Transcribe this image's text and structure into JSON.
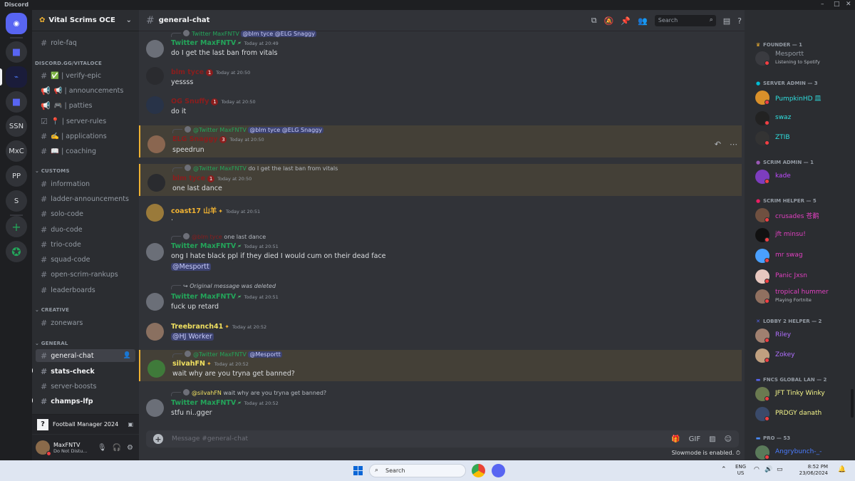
{
  "window": {
    "app_name": "Discord"
  },
  "rail": {
    "servers": [
      {
        "label": "SSN"
      },
      {
        "label": "MxC"
      },
      {
        "label": "PP"
      },
      {
        "label": "S"
      }
    ]
  },
  "server": {
    "name": "Vital Scrims OCE"
  },
  "channels": {
    "top": [
      {
        "name": "role-faq"
      }
    ],
    "cat_vital": "DISCORD.GG/VITALOCE",
    "vital": [
      {
        "name": "✅ | verify-epic"
      },
      {
        "name": "📢 | announcements"
      },
      {
        "name": "🎮 | patties"
      },
      {
        "name": "📍 | server-rules"
      },
      {
        "name": "✍️ | applications"
      },
      {
        "name": "📖 | coaching"
      }
    ],
    "cat_customs": "CUSTOMS",
    "customs": [
      {
        "name": "information"
      },
      {
        "name": "ladder-announcements"
      },
      {
        "name": "solo-code"
      },
      {
        "name": "duo-code"
      },
      {
        "name": "trio-code"
      },
      {
        "name": "squad-code"
      },
      {
        "name": "open-scrim-rankups"
      },
      {
        "name": "leaderboards"
      }
    ],
    "cat_creative": "CREATIVE",
    "creative": [
      {
        "name": "zonewars"
      }
    ],
    "cat_general": "GENERAL",
    "general": [
      {
        "name": "general-chat"
      },
      {
        "name": "stats-check"
      },
      {
        "name": "server-boosts"
      },
      {
        "name": "champs-lfp"
      }
    ]
  },
  "activity": {
    "game": "Football Manager 2024"
  },
  "user": {
    "name": "MaxFNTV",
    "status": "Do Not Distu..."
  },
  "chat": {
    "channel": "general-chat",
    "search_placeholder": "Search",
    "composer_placeholder": "Message #general-chat",
    "slowmode": "Slowmode is enabled."
  },
  "messages": [
    {
      "reply_user": "Twitter MaxFNTV",
      "reply_text": "@blm tyce  @ELG Snaggy",
      "user": "Twitter MaxFNTV",
      "time": "Today at 20:49",
      "text": "do I get the last ban from vitals"
    },
    {
      "user": "blm tyce",
      "time": "Today at 20:50",
      "text": "yessss"
    },
    {
      "user": "OG Snuffy",
      "time": "Today at 20:50",
      "text": "do it"
    },
    {
      "reply_user": "@Twitter MaxFNTV",
      "reply_text": "@blm tyce  @ELG Snaggy",
      "user": "ELG Snaggy",
      "time": "Today at 20:50",
      "text": "speedrun"
    },
    {
      "reply_user": "@Twitter MaxFNTV",
      "reply_text": "do I get the last ban from vitals",
      "user": "blm tyce",
      "time": "Today at 20:50",
      "text": "one last dance"
    },
    {
      "user": "coast17 山羊",
      "time": "Today at 20:51",
      "text": "."
    },
    {
      "reply_user": "@blm tyce",
      "reply_text": "one last dance",
      "user": "Twitter MaxFNTV",
      "time": "Today at 20:51",
      "text": "ong I hate black ppl if they died I would cum on their dead face",
      "mention": "@Mesportt"
    },
    {
      "reply_text": "Original message was deleted",
      "user": "Twitter MaxFNTV",
      "time": "Today at 20:51",
      "text": "fuck up retard"
    },
    {
      "user": "Treebranch41",
      "time": "Today at 20:52",
      "mention": "@HJ Worker"
    },
    {
      "reply_user": "@Twitter MaxFNTV",
      "reply_text": "@Mesportt",
      "user": "silvahFN",
      "time": "Today at 20:52",
      "text": "wait why are you tryna get banned?"
    },
    {
      "reply_user": "@silvahFN",
      "reply_text": "wait why are you tryna get banned?",
      "user": "Twitter MaxFNTV",
      "time": "Today at 20:52",
      "text": "stfu ni..gger"
    }
  ],
  "members": {
    "groups": [
      {
        "title": "FOUNDER — 1",
        "members": [
          {
            "name": "Mesportt",
            "activity": "Listening to Spotify"
          }
        ]
      },
      {
        "title": "SERVER ADMIN — 3",
        "members": [
          {
            "name": "PumpkinHD 皿"
          },
          {
            "name": "swaz"
          },
          {
            "name": "ZTIB"
          }
        ]
      },
      {
        "title": "SCRIM ADMIN — 1",
        "members": [
          {
            "name": "kade"
          }
        ]
      },
      {
        "title": "SCRIM HELPER — 5",
        "members": [
          {
            "name": "crusades 苍鹬"
          },
          {
            "name": "jft minsu!"
          },
          {
            "name": "mr swag"
          },
          {
            "name": "Panic Jxsn"
          },
          {
            "name": "tropical hummer",
            "activity": "Playing Fortnite"
          }
        ]
      },
      {
        "title": "LOBBY 2 HELPER — 2",
        "members": [
          {
            "name": "Riley"
          },
          {
            "name": "Zokey"
          }
        ]
      },
      {
        "title": "FNCS GLOBAL LAN — 2",
        "members": [
          {
            "name": "JFT Tinky Winky"
          },
          {
            "name": "PRDGY danath"
          }
        ]
      },
      {
        "title": "PRO — 53",
        "members": [
          {
            "name": "Angrybunch-_-"
          }
        ]
      }
    ]
  },
  "taskbar": {
    "search_placeholder": "Search",
    "lang": "ENG",
    "region": "US",
    "time": "8:52 PM",
    "date": "23/06/2024"
  },
  "colors": {
    "accent": "#5865f2",
    "mention_bg": "#444037",
    "mention_bar": "#f0b232",
    "dnd": "#f23f43"
  }
}
